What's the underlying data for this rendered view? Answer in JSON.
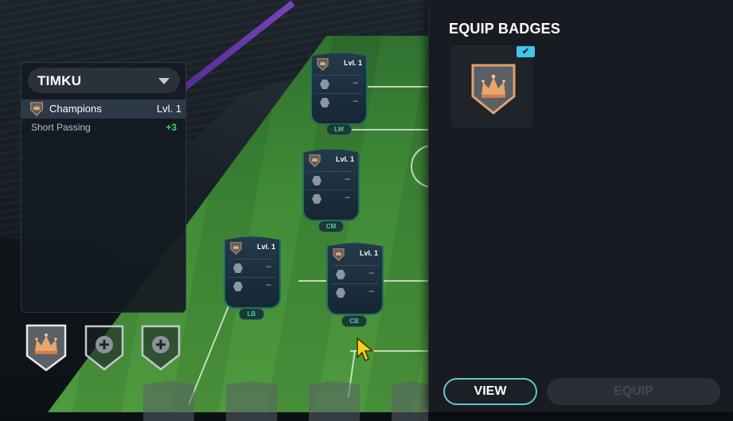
{
  "left_panel": {
    "player_name": "TIMKU",
    "badge": {
      "icon": "crown-shield-icon",
      "name": "Champions",
      "level": "Lvl. 1"
    },
    "stat": {
      "name": "Short Passing",
      "value": "+3"
    },
    "slots": [
      {
        "icon": "crown-shield-icon",
        "filled": true
      },
      {
        "icon": "plus-shield-icon",
        "filled": false
      },
      {
        "icon": "plus-shield-icon",
        "filled": false
      }
    ]
  },
  "cards": [
    {
      "position": "LW",
      "level": "Lvl. 1",
      "row1": "--",
      "row2": "--"
    },
    {
      "position": "CM",
      "level": "Lvl. 1",
      "row1": "--",
      "row2": "--"
    },
    {
      "position": "LB",
      "level": "Lvl. 1",
      "row1": "--",
      "row2": "--"
    },
    {
      "position": "CB",
      "level": "Lvl. 1",
      "row1": "--",
      "row2": "--"
    }
  ],
  "right_panel": {
    "title": "EQUIP BADGES",
    "equipped_check": "✔",
    "view_label": "VIEW",
    "equip_label": "EQUIP"
  },
  "colors": {
    "accent": "#3fc6e8",
    "stat_positive": "#3ed36a",
    "card_border": "#1f6f5e"
  }
}
